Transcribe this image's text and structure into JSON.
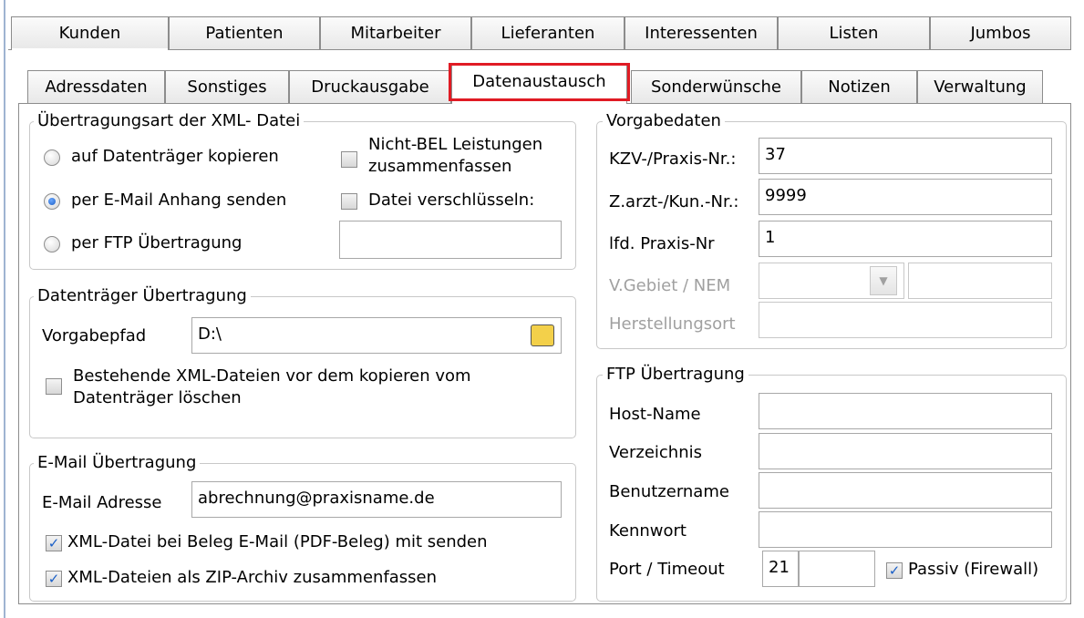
{
  "main_tabs": [
    {
      "label": "Kunden",
      "active": true
    },
    {
      "label": "Patienten",
      "active": false
    },
    {
      "label": "Mitarbeiter",
      "active": false
    },
    {
      "label": "Lieferanten",
      "active": false
    },
    {
      "label": "Interessenten",
      "active": false
    },
    {
      "label": "Listen",
      "active": false
    },
    {
      "label": "Jumbos",
      "active": false
    }
  ],
  "sub_tabs": [
    {
      "label": "Adressdaten",
      "active": false
    },
    {
      "label": "Sonstiges",
      "active": false
    },
    {
      "label": "Druckausgabe",
      "active": false
    },
    {
      "label": "Datenaustausch",
      "active": true
    },
    {
      "label": "Sonderwünsche",
      "active": false
    },
    {
      "label": "Notizen",
      "active": false
    },
    {
      "label": "Verwaltung",
      "active": false
    }
  ],
  "xml_transfer": {
    "title": "Übertragungsart der XML- Datei",
    "radio_copy": "auf Datenträger kopieren",
    "radio_email": "per E-Mail Anhang senden",
    "radio_ftp": "per FTP Übertragung",
    "selected": "per E-Mail Anhang senden",
    "chk_nichtbel_line1": "Nicht-BEL Leistungen",
    "chk_nichtbel_line2": "zusammenfassen",
    "chk_encrypt": "Datei verschlüsseln:",
    "encrypt_value": ""
  },
  "medium_transfer": {
    "title": "Datenträger Übertragung",
    "path_label": "Vorgabepfad",
    "path_value": "D:\\",
    "chk_delete_line1": "Bestehende XML-Dateien vor dem kopieren vom",
    "chk_delete_line2": "Datenträger löschen"
  },
  "email_transfer": {
    "title": "E-Mail Übertragung",
    "address_label": "E-Mail Adresse",
    "address_value": "abrechnung@praxisname.de",
    "chk_pdf": "XML-Datei bei Beleg E-Mail (PDF-Beleg) mit senden",
    "chk_zip": "XML-Dateien als ZIP-Archiv zusammenfassen"
  },
  "defaults": {
    "title": "Vorgabedaten",
    "kzv_label": "KZV-/Praxis-Nr.:",
    "kzv_value": "37",
    "zarzt_label": "Z.arzt-/Kun.-Nr.:",
    "zarzt_value": "9999",
    "lfd_label": "lfd. Praxis-Nr",
    "lfd_value": "1",
    "vgebiet_label": "V.Gebiet / NEM",
    "vgebiet_value": "",
    "vgebiet_extra": "",
    "herst_label": "Herstellungsort",
    "herst_value": ""
  },
  "ftp": {
    "title": "FTP Übertragung",
    "host_label": "Host-Name",
    "host_value": "",
    "dir_label": "Verzeichnis",
    "dir_value": "",
    "user_label": "Benutzername",
    "user_value": "",
    "pass_label": "Kennwort",
    "pass_value": "",
    "port_label": "Port / Timeout",
    "port_value": "21",
    "timeout_value": "",
    "passive_label": "Passiv (Firewall)"
  },
  "icons": {
    "folder": "folder-open-icon",
    "check": "✓",
    "dropdown": "▼"
  },
  "colors": {
    "highlight": "#e01b24",
    "checkmark": "#1a5fc7",
    "disabled_text": "#a0a0a0"
  }
}
